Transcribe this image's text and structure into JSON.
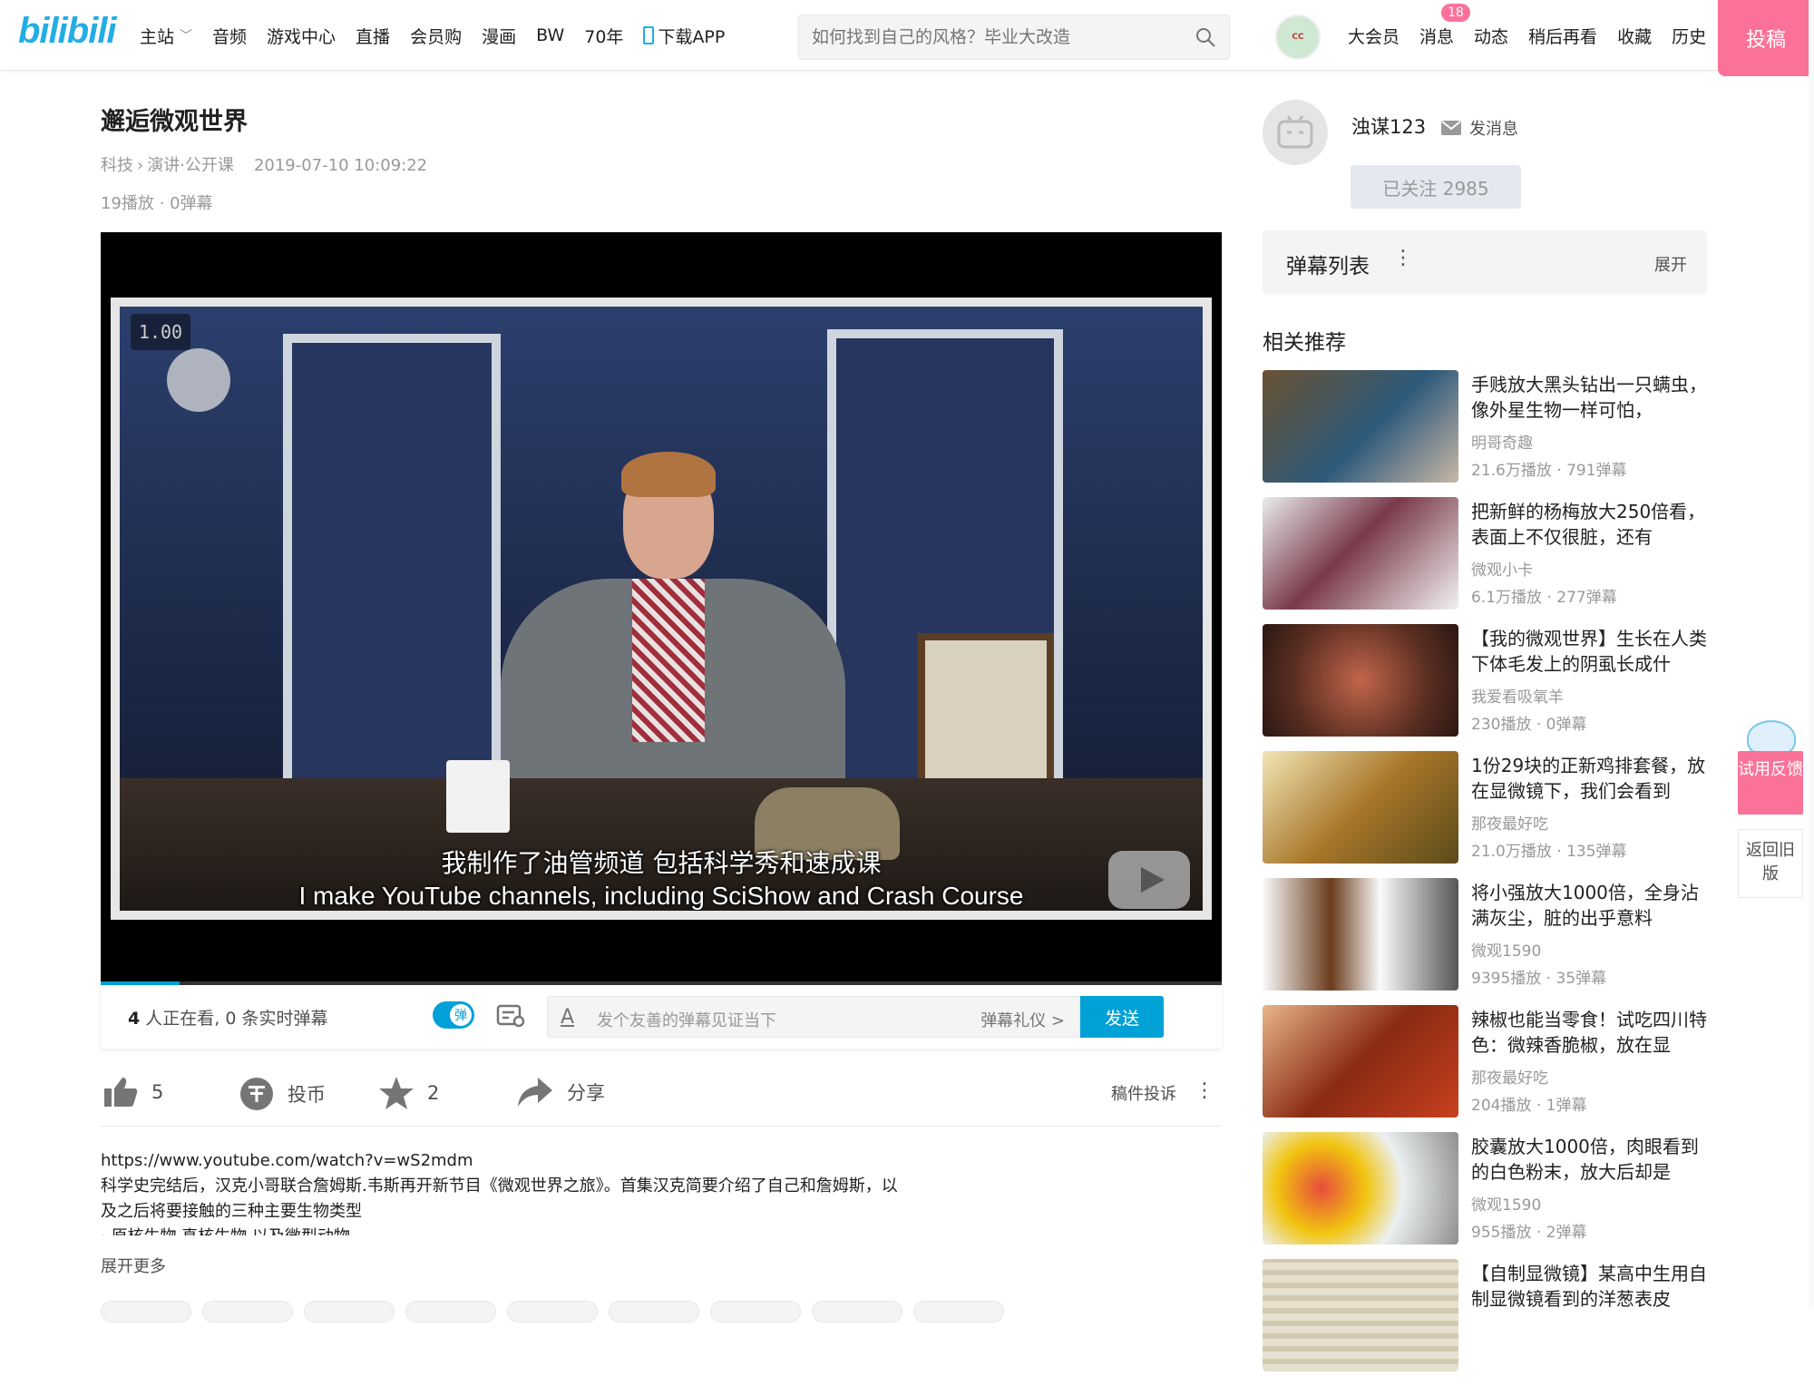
{
  "header": {
    "logo_text": "bilibili",
    "nav": [
      "主站",
      "音频",
      "游戏中心",
      "直播",
      "会员购",
      "漫画",
      "BW",
      "70年"
    ],
    "download_app": "下载APP",
    "search_placeholder": "如何找到自己的风格？毕业大改造",
    "user_nav": [
      "大会员",
      "消息",
      "动态",
      "稍后再看",
      "收藏",
      "历史"
    ],
    "message_badge": "18",
    "upload_label": "投稿",
    "accent_color": "#fb7299",
    "brand_color": "#00a1d6"
  },
  "video": {
    "title": "邂逅微观世界",
    "category": "科技",
    "subcategory": "演讲·公开课",
    "date": "2019-07-10 10:09:22",
    "stats": "19播放 · 0弹幕",
    "speed_label": "1.00",
    "subtitle_zh": "我制作了油管频道 包括科学秀和速成课",
    "subtitle_en": "I make YouTube channels, including SciShow and Crash Course"
  },
  "danmaku_bar": {
    "watching_count": "4",
    "watching_text": "人正在看,",
    "live_count": "0",
    "live_text": "条实时弹幕",
    "toggle_label": "弹",
    "input_placeholder": "发个友善的弹幕见证当下",
    "etiquette": "弹幕礼仪 >",
    "send_label": "发送"
  },
  "actions": {
    "like_count": "5",
    "coin_label": "投币",
    "fav_count": "2",
    "share_label": "分享",
    "report_label": "稿件投诉"
  },
  "description": {
    "link": "https://www.youtube.com/watch?v=wS2mdm",
    "text": "科学史完结后，汉克小哥联合詹姆斯.韦斯再开新节目《微观世界之旅》。首集汉克简要介绍了自己和詹姆斯，以及之后将要接触的三种主要生物类型",
    "line3": "· 原核生物 真核生物 以及微型动物",
    "expand_label": "展开更多"
  },
  "uploader": {
    "name": "浊谋123",
    "message_label": "发消息",
    "follow_label": "已关注 2985"
  },
  "danmaku_list": {
    "title": "弹幕列表",
    "expand": "展开"
  },
  "recommend": {
    "title": "相关推荐",
    "items": [
      {
        "title": "手贱放大黑头钻出一只螨虫，像外星生物一样可怕，",
        "author": "明哥奇趣",
        "stats": "21.6万播放 · 791弹幕"
      },
      {
        "title": "把新鲜的杨梅放大250倍看，表面上不仅很脏，还有",
        "author": "微观小卡",
        "stats": "6.1万播放 · 277弹幕"
      },
      {
        "title": "【我的微观世界】生长在人类下体毛发上的阴虱长成什",
        "author": "我爱看吸氧羊",
        "stats": "230播放 · 0弹幕"
      },
      {
        "title": "1份29块的正新鸡排套餐，放在显微镜下，我们会看到",
        "author": "那夜最好吃",
        "stats": "21.0万播放 · 135弹幕"
      },
      {
        "title": "将小强放大1000倍，全身沾满灰尘，脏的出乎意料",
        "author": "微观1590",
        "stats": "9395播放 · 35弹幕"
      },
      {
        "title": "辣椒也能当零食！试吃四川特色：微辣香脆椒，放在显",
        "author": "那夜最好吃",
        "stats": "204播放 · 1弹幕"
      },
      {
        "title": "胶囊放大1000倍，肉眼看到的白色粉末，放大后却是",
        "author": "微观1590",
        "stats": "955播放 · 2弹幕"
      },
      {
        "title": "【自制显微镜】某高中生用自制显微镜看到的洋葱表皮",
        "author": "",
        "stats": ""
      }
    ]
  },
  "floating": {
    "feedback": "试用反馈",
    "old_version": "返回旧版"
  }
}
